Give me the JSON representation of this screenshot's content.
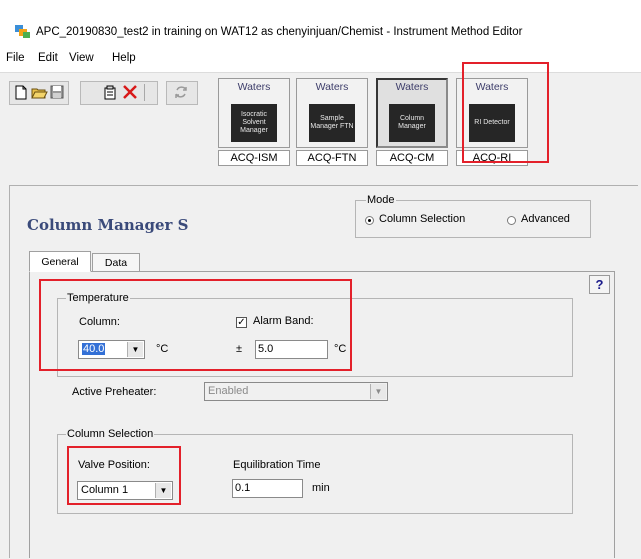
{
  "window": {
    "title": "APC_20190830_test2 in training on WAT12 as chenyinjuan/Chemist - Instrument Method Editor"
  },
  "menu": [
    "File",
    "Edit",
    "View",
    "Help"
  ],
  "toolbar_icons": [
    "new-icon",
    "open-icon",
    "save-icon",
    "properties-icon",
    "delete-icon",
    "refresh-icon"
  ],
  "modules": [
    {
      "brand": "Waters",
      "device": "Isocratic Solvent Manager",
      "label": "ACQ-ISM"
    },
    {
      "brand": "Waters",
      "device": "Sample Manager FTN",
      "label": "ACQ-FTN"
    },
    {
      "brand": "Waters",
      "device": "Column Manager",
      "label": "ACQ-CM",
      "active": true
    },
    {
      "brand": "Waters",
      "device": "RI Detector",
      "label": "ACQ-RI"
    }
  ],
  "panel": {
    "title": "Column Manager S",
    "mode": {
      "legend": "Mode",
      "option_column_selection": "Column Selection",
      "option_advanced": "Advanced",
      "selected": "Column Selection"
    },
    "tabs": [
      "General",
      "Data"
    ],
    "active_tab": "General",
    "help_label": "?",
    "temperature": {
      "legend": "Temperature",
      "column_label": "Column:",
      "column_value": "40.0",
      "column_unit": "°C",
      "alarm_band_label": "Alarm Band:",
      "alarm_band_checked": true,
      "alarm_band_prefix": "±",
      "alarm_band_value": "5.0",
      "alarm_band_unit": "°C"
    },
    "preheater": {
      "label": "Active Preheater:",
      "value": "Enabled"
    },
    "column_selection": {
      "legend": "Column Selection",
      "valve_label": "Valve Position:",
      "valve_value": "Column 1",
      "equilibration_label": "Equilibration Time",
      "equilibration_value": "0.1",
      "equilibration_unit": "min"
    }
  },
  "colors": {
    "highlight": "#e3202a",
    "title_text": "#3a4a7a",
    "selection": "#3370d6"
  }
}
